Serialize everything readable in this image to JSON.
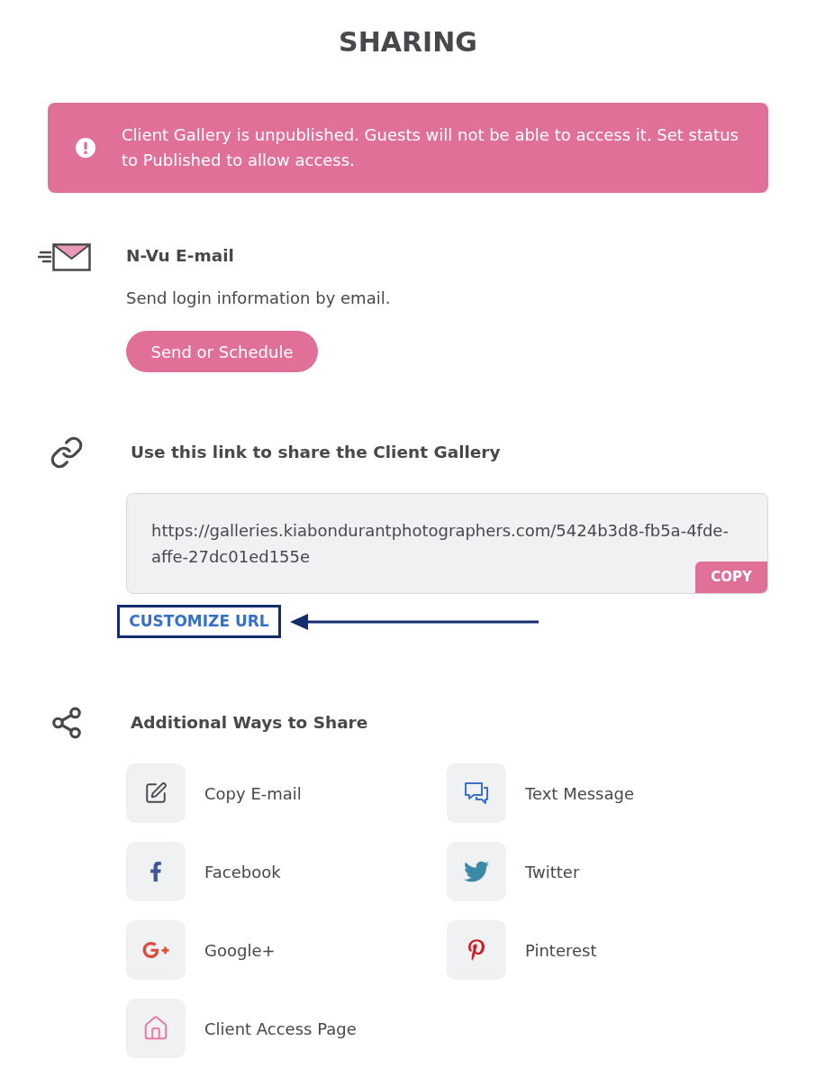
{
  "page": {
    "title": "SHARING"
  },
  "alert": {
    "message": "Client Gallery is unpublished. Guests will not be able to access it. Set status to Published to allow access."
  },
  "email_section": {
    "heading": "N-Vu E-mail",
    "description": "Send login information by email.",
    "button": "Send or Schedule"
  },
  "link_section": {
    "heading": "Use this link to share the Client Gallery",
    "url": "https://galleries.kiabondurantphotographers.com/5424b3d8-fb5a-4fde-affe-27dc01ed155e",
    "copy_button": "COPY",
    "customize_link": "CUSTOMIZE URL"
  },
  "share_section": {
    "heading": "Additional Ways to Share",
    "options": [
      {
        "kind": "copy_email",
        "label": "Copy E-mail"
      },
      {
        "kind": "text_message",
        "label": "Text Message"
      },
      {
        "kind": "facebook",
        "label": "Facebook"
      },
      {
        "kind": "twitter",
        "label": "Twitter"
      },
      {
        "kind": "google_plus",
        "label": "Google+"
      },
      {
        "kind": "pinterest",
        "label": "Pinterest"
      },
      {
        "kind": "client_access",
        "label": "Client Access Page"
      }
    ]
  }
}
